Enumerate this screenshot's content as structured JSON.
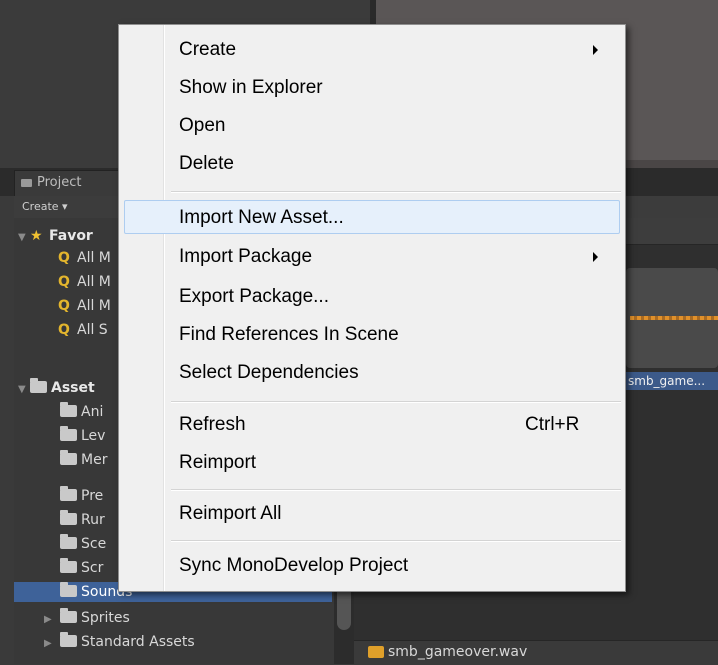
{
  "project_panel": {
    "tab_label": "Project",
    "create_dropdown": "Create ▾",
    "favorites_label": "Favor",
    "favorites": [
      "All M",
      "All M",
      "All M",
      "All S"
    ],
    "assets_label": "Asset",
    "asset_folders": [
      "Ani",
      "Lev",
      "Mer",
      "Pre",
      "Rur",
      "Sce",
      "Scr"
    ],
    "selected_folder": "Sounds",
    "sprites_label": "Sprites",
    "standard_assets_label": "Standard Assets"
  },
  "asset_grid": {
    "thumb_label": "smb_game...",
    "bottom_file": "smb_gameover.wav"
  },
  "context_menu": {
    "create": "Create",
    "show_in_explorer": "Show in Explorer",
    "open": "Open",
    "delete": "Delete",
    "import_new_asset": "Import New Asset...",
    "import_package": "Import Package",
    "export_package": "Export Package...",
    "find_references": "Find References In Scene",
    "select_dependencies": "Select Dependencies",
    "refresh": "Refresh",
    "refresh_shortcut": "Ctrl+R",
    "reimport": "Reimport",
    "reimport_all": "Reimport All",
    "sync_monodevelop": "Sync MonoDevelop Project"
  },
  "colors": {
    "selection": "#3e6299",
    "menu_bg": "#f0f0f0",
    "menu_highlight": "#e6f0fb",
    "favorite_search_icon": "#e3b52d"
  },
  "icons": [
    "folder-icon",
    "search-icon",
    "star-icon",
    "submenu-arrow-icon",
    "audio-file-icon"
  ]
}
